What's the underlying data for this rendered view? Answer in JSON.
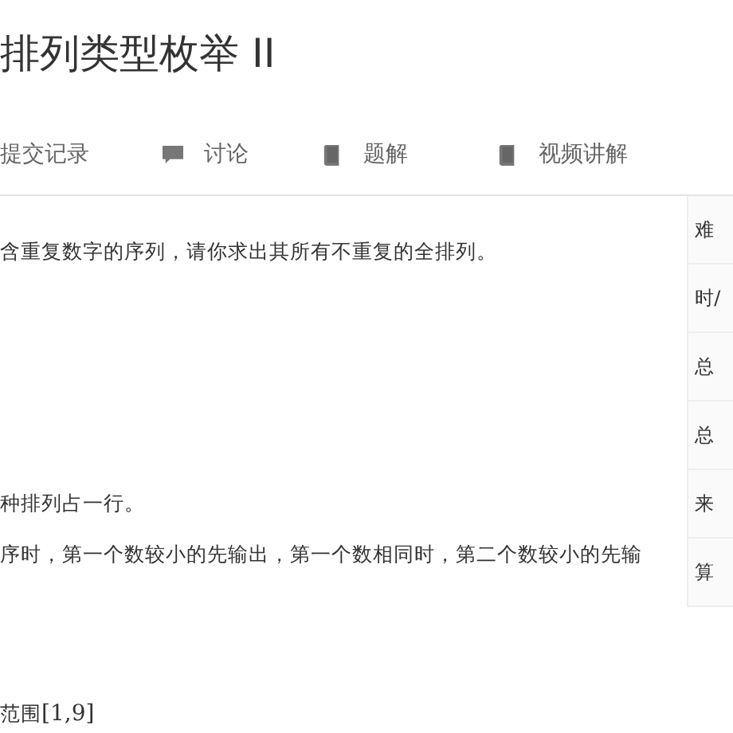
{
  "title": "排列类型枚举 II",
  "tabs": [
    {
      "label": "提交记录",
      "kind": "plain"
    },
    {
      "label": "讨论",
      "kind": "chat"
    },
    {
      "label": "题解",
      "kind": "book"
    },
    {
      "label": "视频讲解",
      "kind": "book"
    }
  ],
  "paragraphs": [
    {
      "text": "含重复数字的序列，请你求出其所有不重复的全排列。"
    },
    {
      "text": "种排列占一行。"
    },
    {
      "text": "序时，第一个数较小的先输出，第一个数相同时，第二个数较小的先输"
    },
    {
      "text": "范围",
      "math": "[1,9]"
    }
  ],
  "sidebar": {
    "rows": [
      "难",
      "时/",
      "总",
      "总",
      "来",
      "算"
    ]
  }
}
